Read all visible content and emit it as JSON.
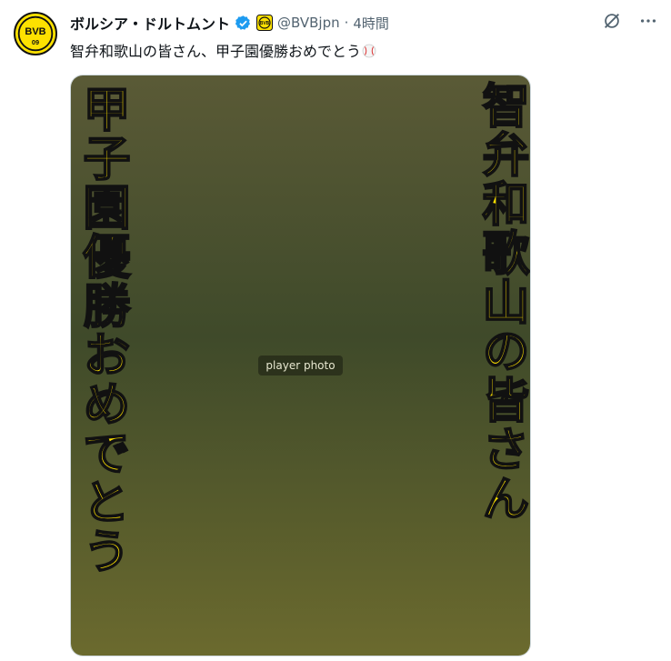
{
  "account": {
    "display_name": "ボルシア・ドルトムント",
    "handle": "@BVBjpn",
    "separator": "·",
    "time": "4時間",
    "avatar_text": "BVB",
    "avatar_number": "09"
  },
  "tweet": {
    "text": "智弁和歌山の皆さん、甲子園優勝おめでとう",
    "emoji_icon": "baseball-icon"
  },
  "media": {
    "left_caption": "甲子園優勝おめでとう",
    "right_caption": "智弁和歌山の皆さん",
    "photo_label": "player photo"
  },
  "icons": {
    "verified": "verified-badge-icon",
    "affiliate": "bvb-affiliate-icon",
    "grok": "grok-icon",
    "more": "more-icon"
  },
  "colors": {
    "brand_yellow": "#fde100",
    "verified_blue": "#1d9bf0",
    "secondary_text": "#536471"
  }
}
